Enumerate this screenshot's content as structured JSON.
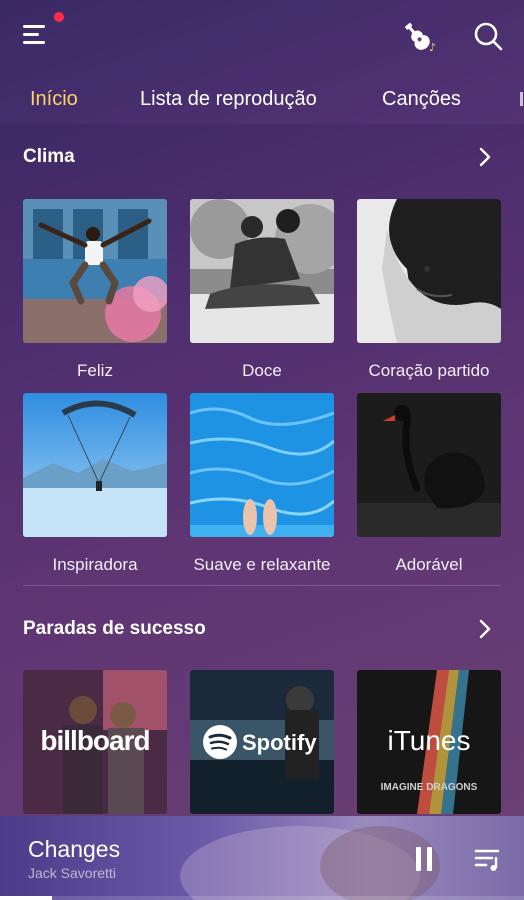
{
  "header": {
    "menu_icon": "hamburger-menu-icon",
    "notification_color": "#ff2d4a",
    "guitar_icon": "guitar-icon",
    "search_icon": "search-icon"
  },
  "tabs": [
    {
      "label": "Início",
      "active": true
    },
    {
      "label": "Lista de reprodução",
      "active": false
    },
    {
      "label": "Canções",
      "active": false
    }
  ],
  "accent_color": "#ffd36b",
  "mood_section": {
    "title": "Clima",
    "items": [
      {
        "label": "Feliz"
      },
      {
        "label": "Doce"
      },
      {
        "label": "Coração partido"
      },
      {
        "label": "Inspiradora"
      },
      {
        "label": "Suave e relaxante"
      },
      {
        "label": "Adorável"
      }
    ]
  },
  "charts_section": {
    "title": "Paradas de sucesso",
    "items": [
      {
        "brand": "billboard"
      },
      {
        "brand": "Spotify"
      },
      {
        "brand": "iTunes",
        "overlay_text": "IMAGINE DRAGONS"
      }
    ]
  },
  "player": {
    "title": "Changes",
    "artist": "Jack Savoretti",
    "progress": 0.1,
    "pause_icon": "pause-icon",
    "queue_icon": "playlist-queue-icon"
  }
}
